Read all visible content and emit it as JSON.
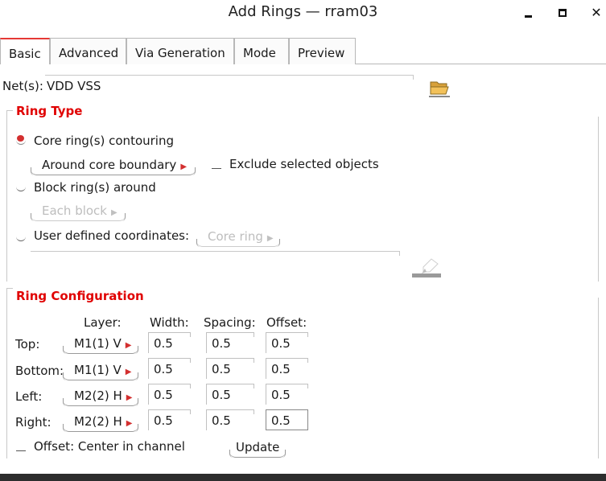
{
  "window": {
    "title": "Add Rings — rram03",
    "min_label": "",
    "max_label": "",
    "close_label": "✕"
  },
  "tabs": [
    {
      "label": "Basic",
      "active": true
    },
    {
      "label": "Advanced"
    },
    {
      "label": "Via Generation"
    },
    {
      "label": "Mode"
    },
    {
      "label": "Preview"
    }
  ],
  "nets": {
    "label": "Net(s):",
    "value": "VDD VSS"
  },
  "ring_type": {
    "title": "Ring Type",
    "core_ring_label": "Core ring(s) contouring",
    "core_boundary_button": "Around core boundary",
    "exclude_label": "Exclude selected objects",
    "block_ring_label": "Block ring(s) around",
    "each_block_button": "Each block",
    "user_coords_label": "User defined coordinates:",
    "core_ring_button": "Core ring",
    "coords_value": ""
  },
  "ring_config": {
    "title": "Ring Configuration",
    "headers": {
      "layer": "Layer:",
      "width": "Width:",
      "spacing": "Spacing:",
      "offset": "Offset:"
    },
    "rows": [
      {
        "side": "Top:",
        "layer": "M1(1) V",
        "width": "0.5",
        "spacing": "0.5",
        "offset": "0.5"
      },
      {
        "side": "Bottom:",
        "layer": "M1(1) V",
        "width": "0.5",
        "spacing": "0.5",
        "offset": "0.5"
      },
      {
        "side": "Left:",
        "layer": "M2(2) H",
        "width": "0.5",
        "spacing": "0.5",
        "offset": "0.5"
      },
      {
        "side": "Right:",
        "layer": "M2(2) H",
        "width": "0.5",
        "spacing": "0.5",
        "offset": "0.5"
      }
    ],
    "center_label": "Offset: Center in channel",
    "update_button": "Update"
  },
  "icons": {
    "browse": "folder-open-icon",
    "draw": "pen-draw-icon",
    "dropdown": "triangle-right-icon"
  },
  "colors": {
    "accent": "#e00000",
    "radio_selected": "#d32f2f"
  }
}
